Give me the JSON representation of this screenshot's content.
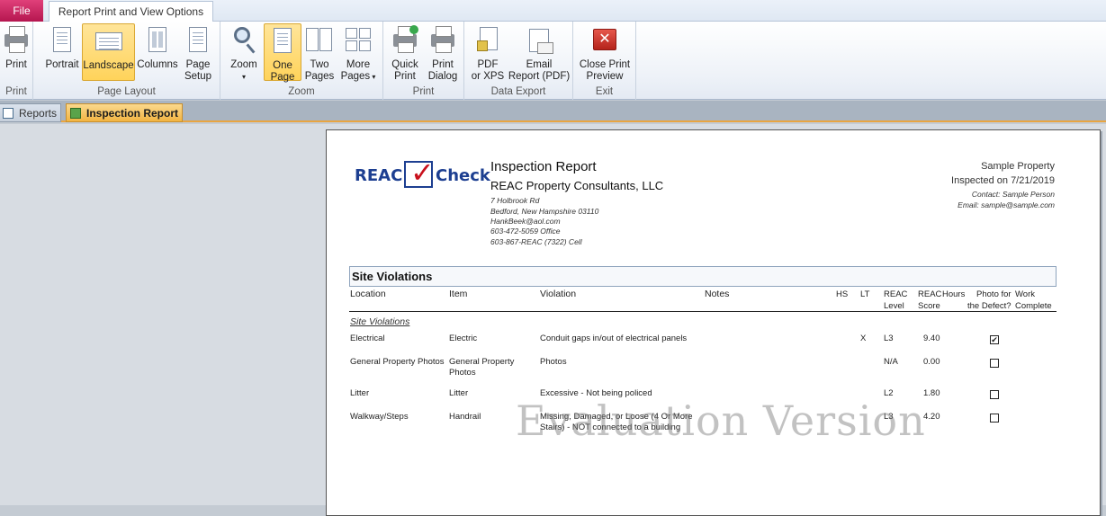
{
  "ribbon": {
    "file_tab": "File",
    "active_tab": "Report Print and View Options",
    "groups": {
      "print": {
        "label": "Print",
        "print": "Print"
      },
      "page_layout": {
        "label": "Page Layout",
        "portrait": "Portrait",
        "landscape": "Landscape",
        "columns": "Columns",
        "page_setup_1": "Page",
        "page_setup_2": "Setup"
      },
      "zoom": {
        "label": "Zoom",
        "zoom": "Zoom",
        "one_page_1": "One",
        "one_page_2": "Page",
        "two_pages_1": "Two",
        "two_pages_2": "Pages",
        "more_pages_1": "More",
        "more_pages_2": "Pages"
      },
      "print2": {
        "label": "Print",
        "quick_print_1": "Quick",
        "quick_print_2": "Print",
        "print_dialog_1": "Print",
        "print_dialog_2": "Dialog"
      },
      "data_export": {
        "label": "Data Export",
        "pdf_1": "PDF",
        "pdf_2": "or XPS",
        "email_1": "Email",
        "email_2": "Report (PDF)"
      },
      "exit": {
        "label": "Exit",
        "close_1": "Close Print",
        "close_2": "Preview"
      }
    }
  },
  "doc_tabs": {
    "reports": "Reports",
    "inspection": "Inspection Report"
  },
  "report": {
    "logo_left": "REAC",
    "logo_right": "Check",
    "title": "Inspection Report",
    "company": "REAC Property Consultants, LLC",
    "address": [
      "7 Holbrook Rd",
      "Bedford, New Hampshire 03110",
      "HankBeek@aol.com",
      "603-472-5059 Office",
      "603-867-REAC (7322) Cell"
    ],
    "property": "Sample Property",
    "inspected": "Inspected on 7/21/2019",
    "contact": "Contact: Sample Person",
    "email": "Email: sample@sample.com",
    "section_title": "Site Violations",
    "headers": {
      "location": "Location",
      "item": "Item",
      "violation": "Violation",
      "notes": "Notes",
      "hs": "HS",
      "lt": "LT",
      "reac_level_1": "REAC",
      "reac_level_2": "Level",
      "reac_score_1": "REAC",
      "reac_score_2": "Score",
      "hours": "Hours",
      "photo_1": "Photo for",
      "photo_2": "the Defect?",
      "work_1": "Work",
      "work_2": "Complete"
    },
    "group_label": "Site Violations",
    "rows": [
      {
        "location": "Electrical",
        "item": "Electric",
        "violation": "Conduit gaps in/out of electrical panels",
        "lt": "X",
        "level": "L3",
        "score": "9.40",
        "photo": "✔"
      },
      {
        "location": "General Property Photos",
        "item": "General Property Photos",
        "violation": "Photos",
        "lt": "",
        "level": "N/A",
        "score": "0.00",
        "photo": ""
      },
      {
        "location": "Litter",
        "item": "Litter",
        "violation": "Excessive - Not being policed",
        "lt": "",
        "level": "L2",
        "score": "1.80",
        "photo": ""
      },
      {
        "location": "Walkway/Steps",
        "item": "Handrail",
        "violation": "Missing, Damaged, or Loose (4 Or More Stairs) - NOT connected to a building",
        "lt": "",
        "level": "L3",
        "score": "4.20",
        "photo": ""
      }
    ],
    "watermark": "Evaluation Version"
  }
}
